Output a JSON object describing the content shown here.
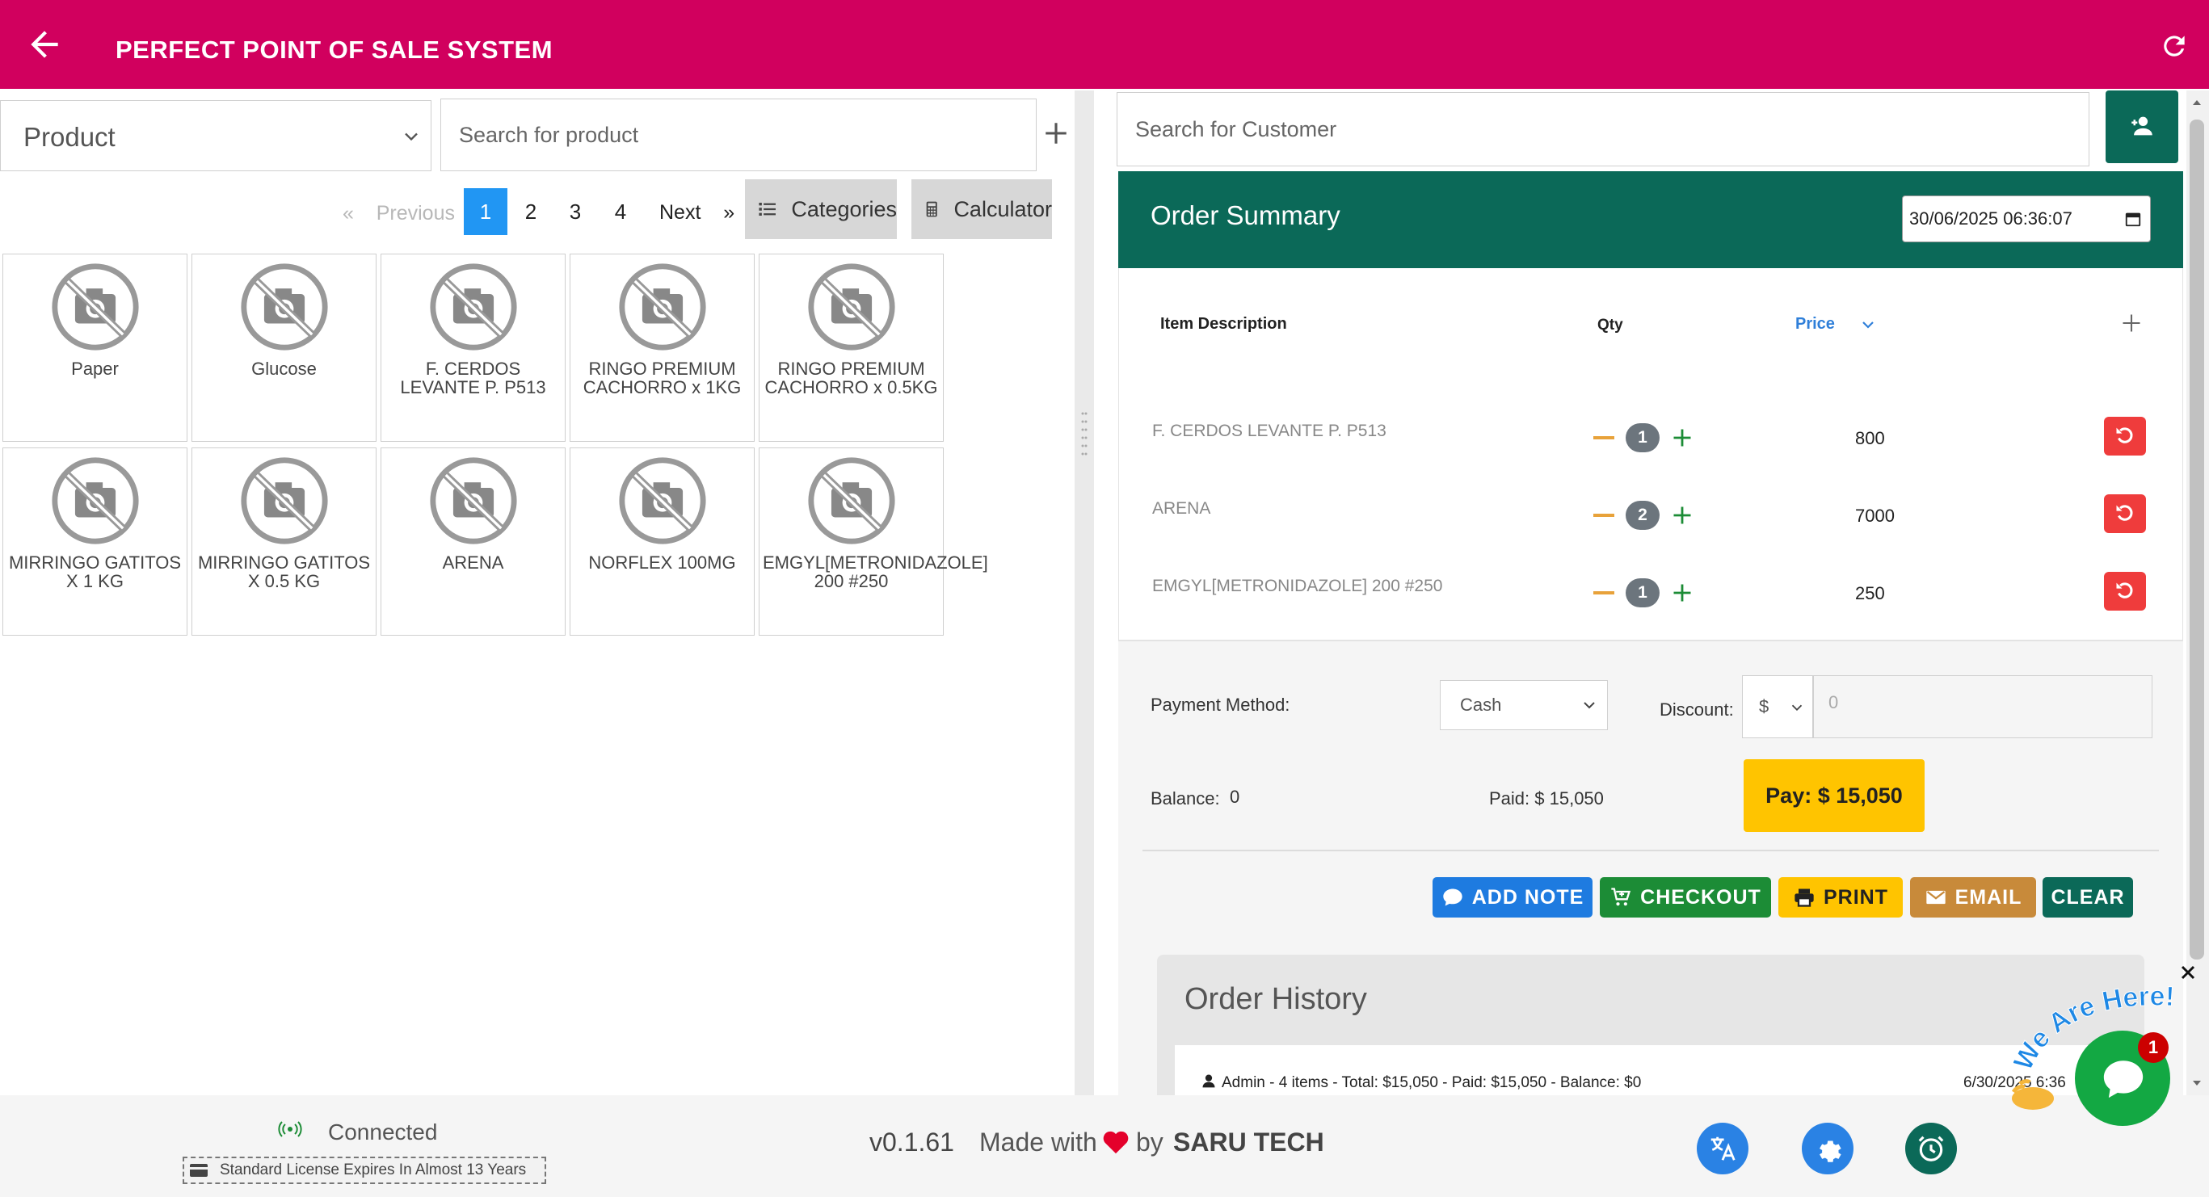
{
  "header": {
    "title": "PERFECT POINT OF SALE SYSTEM"
  },
  "product_panel": {
    "category_select": "Product",
    "search_placeholder": "Search for product",
    "pagination": {
      "prev_symbol": "«",
      "prev_label": "Previous",
      "pages": [
        "1",
        "2",
        "3",
        "4"
      ],
      "active_page": "1",
      "next_label": "Next",
      "next_symbol": "»"
    },
    "categories_label": "Categories",
    "calculator_label": "Calculator",
    "products": [
      {
        "name": "Paper"
      },
      {
        "name": "Glucose"
      },
      {
        "name": "F. CERDOS LEVANTE P. P513"
      },
      {
        "name": "RINGO PREMIUM CACHORRO x 1KG"
      },
      {
        "name": "RINGO PREMIUM CACHORRO x 0.5KG"
      },
      {
        "name": "MIRRINGO GATITOS X 1 KG"
      },
      {
        "name": "MIRRINGO GATITOS X 0.5 KG"
      },
      {
        "name": "ARENA"
      },
      {
        "name": "NORFLEX 100MG"
      },
      {
        "name": "EMGYL[METRONIDAZOLE] 200 #250"
      }
    ]
  },
  "customer": {
    "search_placeholder": "Search for Customer"
  },
  "order_summary": {
    "title": "Order Summary",
    "datetime": "30/06/2025 06:36:07",
    "columns": {
      "item": "Item Description",
      "qty": "Qty",
      "price": "Price"
    },
    "lines": [
      {
        "name": "F. CERDOS LEVANTE P. P513",
        "qty": "1",
        "price": "800"
      },
      {
        "name": "ARENA",
        "qty": "2",
        "price": "7000"
      },
      {
        "name": "EMGYL[METRONIDAZOLE] 200 #250",
        "qty": "1",
        "price": "250"
      }
    ]
  },
  "payment": {
    "method_label": "Payment Method:",
    "method_value": "Cash",
    "discount_label": "Discount:",
    "discount_type": "$",
    "discount_value": "0",
    "balance_label": "Balance:",
    "balance_value": "0",
    "paid_text": "Paid: $ 15,050",
    "pay_button": "Pay: $ 15,050"
  },
  "actions": {
    "add_note": "ADD NOTE",
    "checkout": "CHECKOUT",
    "print": "PRINT",
    "email": "EMAIL",
    "clear": "CLEAR"
  },
  "order_history": {
    "title": "Order History",
    "entries": [
      {
        "text": "Admin -   4 items - Total: $15,050 - Paid: $15,050 - Balance: $0",
        "date": "6/30/2025 6:36"
      }
    ]
  },
  "footer": {
    "status": "Connected",
    "license": "Standard License Expires In Almost 13 Years",
    "version": "v0.1.61",
    "made_with": "Made with",
    "by": "by",
    "brand": "SARU TECH"
  },
  "chat": {
    "banner": "We Are Here!",
    "badge": "1"
  },
  "colors": {
    "header": "#d1005e",
    "teal": "#0b6958",
    "active_page": "#2196f3",
    "pay": "#ffc400",
    "delete": "#ef3c3c",
    "add_note": "#1e7be0",
    "checkout": "#1c8c36",
    "print": "#ffc400",
    "email": "#c88a3a",
    "clear": "#0b6958",
    "chat": "#13a843"
  }
}
